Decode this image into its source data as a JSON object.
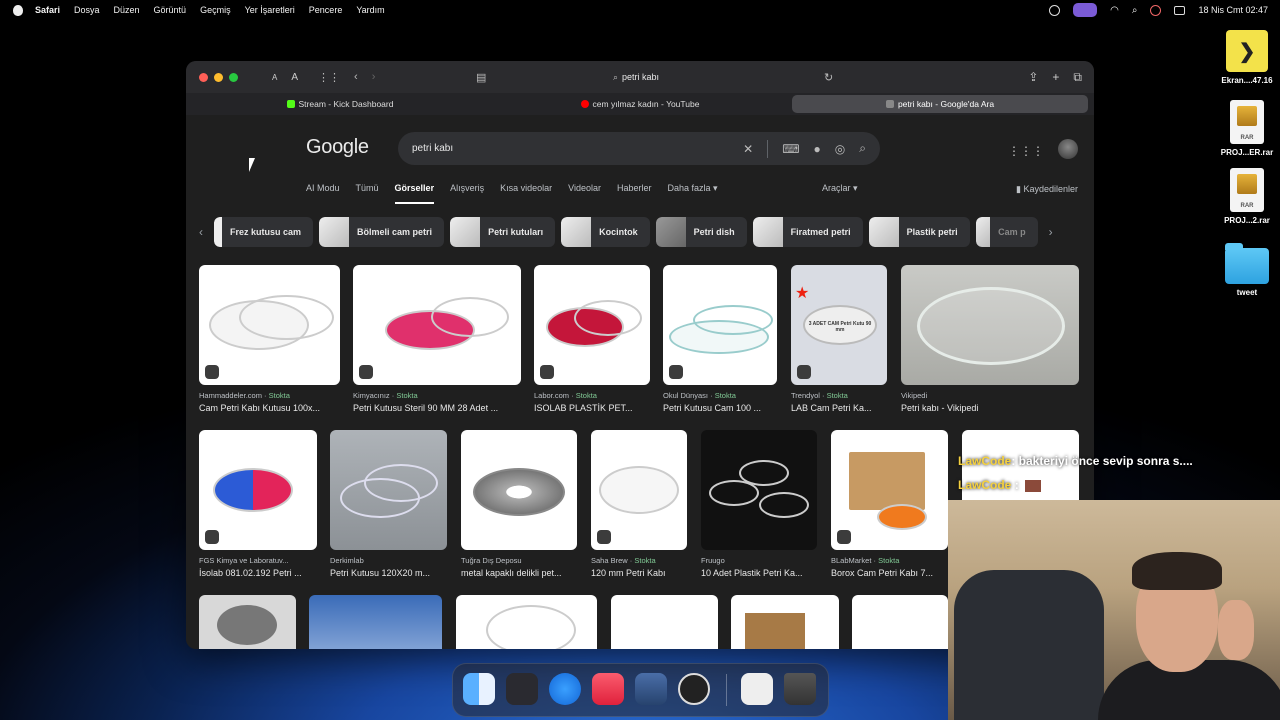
{
  "menubar": {
    "app": "Safari",
    "items": [
      "Dosya",
      "Düzen",
      "Görüntü",
      "Geçmiş",
      "Yer İşaretleri",
      "Pencere",
      "Yardım"
    ],
    "clock": "18 Nis Cmt  02:47"
  },
  "desktop": {
    "icons": [
      {
        "label": "Ekran....47.16",
        "kind": "screenshot"
      },
      {
        "label": "PROJ...ER.rar",
        "kind": "rar"
      },
      {
        "label": "PROJ...2.rar",
        "kind": "rar"
      },
      {
        "label": "tweet",
        "kind": "folder"
      }
    ]
  },
  "browser": {
    "toolbar": {
      "text_small": "A",
      "text_large": "A",
      "address": "petri kabı"
    },
    "tabs": [
      {
        "label": "Stream - Kick Dashboard",
        "favicon_color": "#53fc18",
        "active": false
      },
      {
        "label": "cem yılmaz kadın - YouTube",
        "favicon_color": "#ff0000",
        "active": false
      },
      {
        "label": "petri kabı - Google'da Ara",
        "favicon_color": "#888888",
        "active": true
      }
    ]
  },
  "google": {
    "logo": "Google",
    "query": "petri kabı",
    "nav": [
      "AI Modu",
      "Tümü",
      "Görseller",
      "Alışveriş",
      "Kısa videolar",
      "Videolar",
      "Haberler",
      "Daha fazla ▾"
    ],
    "active_nav": "Görseller",
    "tools": "Araçlar ▾",
    "saved": "Kaydedilenler",
    "chips": [
      "Frez kutusu cam",
      "Bölmeli cam petri",
      "Petri kutuları",
      "Kocintok",
      "Petri dish",
      "Firatmed petri",
      "Plastik petri",
      "Cam p"
    ],
    "results_row1": [
      {
        "source": "Hammaddeler.com",
        "stock": "Stokta",
        "title": "Cam Petri Kabı Kutusu 100x..."
      },
      {
        "source": "Kimyacınız",
        "stock": "Stokta",
        "title": "Petri Kutusu Steril 90 MM 28 Adet ..."
      },
      {
        "source": "Labor.com",
        "stock": "Stokta",
        "title": "ISOLAB PLASTİK PET..."
      },
      {
        "source": "Okul Dünyası",
        "stock": "Stokta",
        "title": "Petri Kutusu Cam 100 ..."
      },
      {
        "source": "Trendyol",
        "stock": "Stokta",
        "title": "LAB Cam Petri Ka...",
        "img_text": "3 ADET CAM Petri Kutu 90 mm"
      },
      {
        "source": "Vikipedi",
        "stock": "",
        "title": "Petri kabı - Vikipedi"
      }
    ],
    "results_row2": [
      {
        "source": "FGS Kimya ve Laboratuv...",
        "stock": "",
        "title": "İsolab 081.02.192 Petri ..."
      },
      {
        "source": "Derkimlab",
        "stock": "",
        "title": "Petri Kutusu 120X20 m..."
      },
      {
        "source": "Tuğra Dış Deposu",
        "stock": "",
        "title": "metal kapaklı delikli pet..."
      },
      {
        "source": "Saha Brew",
        "stock": "Stokta",
        "title": "120 mm Petri Kabı"
      },
      {
        "source": "Fruugo",
        "stock": "",
        "title": "10 Adet Plastik Petri Ka..."
      },
      {
        "source": "BLabMarket",
        "stock": "Stokta",
        "title": "Borox Cam Petri Kabı 7..."
      }
    ]
  },
  "chat": [
    {
      "user": "LawCode",
      "message": ": bakteriyi önce sevip sonra s...."
    },
    {
      "user": "LawCode",
      "message": ":"
    }
  ]
}
